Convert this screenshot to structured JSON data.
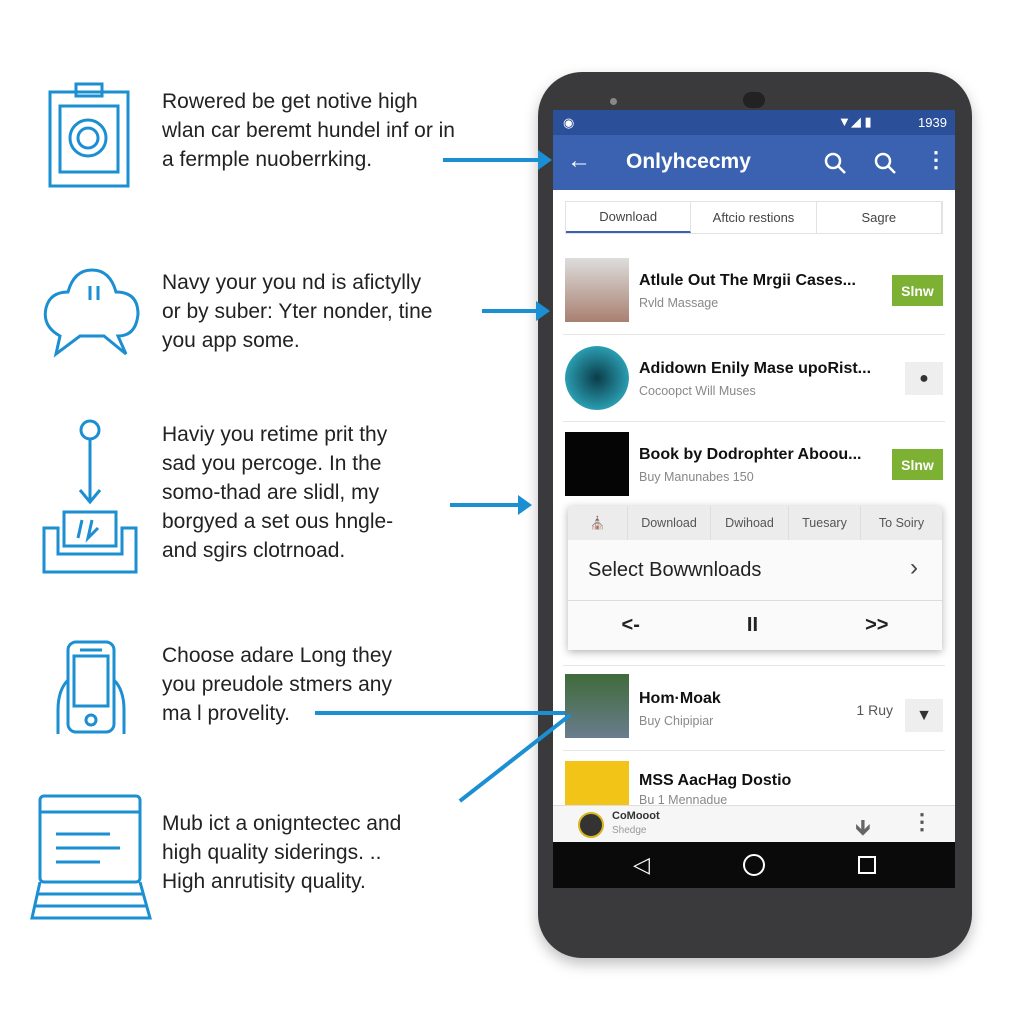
{
  "features": [
    {
      "icon": "clipboard-icon",
      "lines": [
        "Rowered be get notive high",
        "wlan car beremt hundel inf or in",
        "a fermple nuoberrking."
      ]
    },
    {
      "icon": "chat-bubble-icon",
      "lines": [
        "Navy your you nd is afictylly",
        "or by suber: Yter nonder, tine",
        "you app some."
      ]
    },
    {
      "icon": "download-tray-icon",
      "lines": [
        "Haviy you retime prit thy",
        "sad you percoge. In the",
        "somo-thad are slidl, my",
        "borgyed a set ous hngle-",
        "and sgirs clotrnoad."
      ]
    },
    {
      "icon": "smartphone-icon",
      "lines": [
        "Choose adare Long they",
        "you preudole stmers any",
        "ma l provelity."
      ]
    },
    {
      "icon": "laptop-icon",
      "lines": [
        "Mub ict a onigntectec and",
        "high quality siderings. ..",
        "High anrutisity quality."
      ]
    }
  ],
  "status": {
    "time": "1939"
  },
  "appbar": {
    "title": "Onlyhcecmy"
  },
  "tabs": [
    "Download",
    "Aftcio restions",
    "Sagre"
  ],
  "list": [
    {
      "title": "Atlule Out The Mrgii Cases...",
      "subtitle": "Rvld Massage",
      "action": "Slnw"
    },
    {
      "title": "Adidown Enily Mase upoRist...",
      "subtitle": "Cocoopct Will Muses",
      "action": ""
    },
    {
      "title": "Book by Dodrophter Aboou...",
      "subtitle": "Buy Manunabes 150",
      "action": "Slnw"
    },
    {
      "title": "Hom·Moak",
      "subtitle": "Buy Chipipiar",
      "meta": "1 Ruy"
    },
    {
      "title": "MSS AacHag Dostio",
      "subtitle": "Bu 1 Mennadue"
    }
  ],
  "popup": {
    "tabs": [
      "Download",
      "Dwihoad",
      "Tuesary",
      "To Soiry"
    ],
    "title": "Select Bowwnloads",
    "controls": [
      "<-",
      "II",
      ">>"
    ]
  },
  "mini_player": {
    "title": "CoMooot",
    "subtitle": "Shedge"
  },
  "colors": {
    "accent": "#1b8fd2",
    "appbar": "#3a62b0",
    "green": "#7cb133"
  }
}
